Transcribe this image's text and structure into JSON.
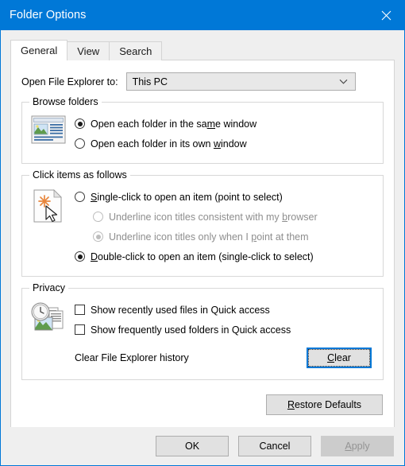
{
  "window": {
    "title": "Folder Options",
    "close_icon": "close-icon",
    "accent_color": "#0078d7",
    "titlebar_text_color": "#ffffff"
  },
  "tabs": [
    {
      "label": "General",
      "active": true
    },
    {
      "label": "View",
      "active": false
    },
    {
      "label": "Search",
      "active": false
    }
  ],
  "open_explorer": {
    "label": "Open File Explorer to:",
    "value": "This PC",
    "arrow_icon": "chevron-down-icon"
  },
  "browse_folders": {
    "title": "Browse folders",
    "icon": "window-preview-icon",
    "options": [
      {
        "label": "Open each folder in the same window",
        "accel": "m",
        "checked": true,
        "disabled": false
      },
      {
        "label": "Open each folder in its own window",
        "accel": "w",
        "checked": false,
        "disabled": false
      }
    ]
  },
  "click_items": {
    "title": "Click items as follows",
    "icon": "document-pointer-icon",
    "options": [
      {
        "label": "Single-click to open an item (point to select)",
        "accel": "S",
        "checked": false,
        "disabled": false,
        "indent": false
      },
      {
        "label": "Underline icon titles consistent with my browser",
        "accel": "b",
        "checked": false,
        "disabled": true,
        "indent": true
      },
      {
        "label": "Underline icon titles only when I point at them",
        "accel": "p",
        "checked": true,
        "disabled": true,
        "indent": true
      },
      {
        "label": "Double-click to open an item (single-click to select)",
        "accel": "D",
        "checked": true,
        "disabled": false,
        "indent": false
      }
    ]
  },
  "privacy": {
    "title": "Privacy",
    "icon": "clock-documents-icon",
    "checkboxes": [
      {
        "label": "Show recently used files in Quick access",
        "checked": false
      },
      {
        "label": "Show frequently used folders in Quick access",
        "checked": false
      }
    ],
    "clear_history_label": "Clear File Explorer history",
    "clear_button": {
      "label": "Clear",
      "accel": "C",
      "focused": true
    }
  },
  "restore_defaults": {
    "label": "Restore Defaults",
    "accel": "R"
  },
  "footer": {
    "ok": {
      "label": "OK",
      "disabled": false
    },
    "cancel": {
      "label": "Cancel",
      "disabled": false
    },
    "apply": {
      "label": "Apply",
      "accel": "A",
      "disabled": true
    }
  }
}
